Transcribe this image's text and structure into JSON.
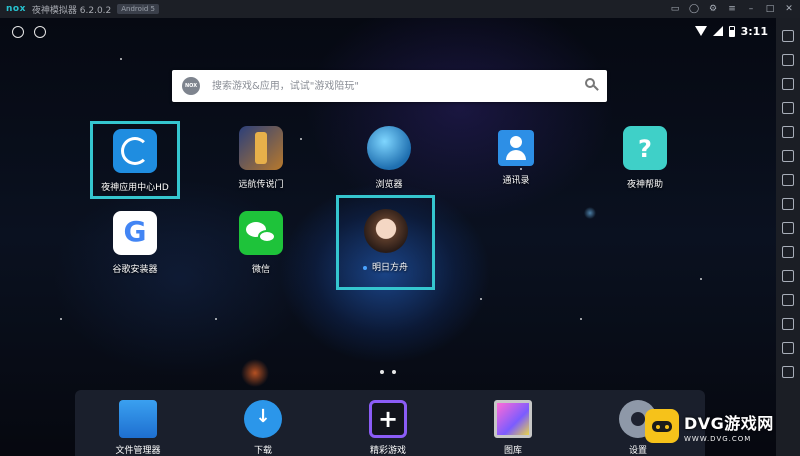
{
  "titlebar": {
    "logo": "nox",
    "app_title": "夜神模拟器 6.2.0.2",
    "android_badge": "Android 5"
  },
  "status_bar": {
    "time": "3:11"
  },
  "search": {
    "placeholder": "搜索游戏&应用，试试\"游戏陪玩\"",
    "logo_text": "NOX"
  },
  "apps": [
    {
      "label": "夜神应用中心HD",
      "icon": "nox-app-center-icon"
    },
    {
      "label": "远航传说门",
      "icon": "game-door-icon"
    },
    {
      "label": "浏览器",
      "icon": "browser-globe-icon"
    },
    {
      "label": "通讯录",
      "icon": "contacts-icon"
    },
    {
      "label": "夜神帮助",
      "icon": "help-question-icon"
    },
    {
      "label": "谷歌安装器",
      "icon": "google-g-icon"
    },
    {
      "label": "微信",
      "icon": "wechat-icon"
    },
    {
      "label": "明日方舟",
      "icon": "arknights-character-icon"
    }
  ],
  "dock": [
    {
      "label": "文件管理器",
      "icon": "folder-icon"
    },
    {
      "label": "下载",
      "icon": "download-icon"
    },
    {
      "label": "精彩游戏",
      "icon": "plus-icon"
    },
    {
      "label": "图库",
      "icon": "gallery-icon"
    },
    {
      "label": "设置",
      "icon": "settings-gear-icon"
    }
  ],
  "watermark": {
    "title": "DVG游戏网",
    "url": "WWW.DVG.COM"
  },
  "colors": {
    "highlight": "#35c6cf",
    "accent": "#27c2cf"
  }
}
